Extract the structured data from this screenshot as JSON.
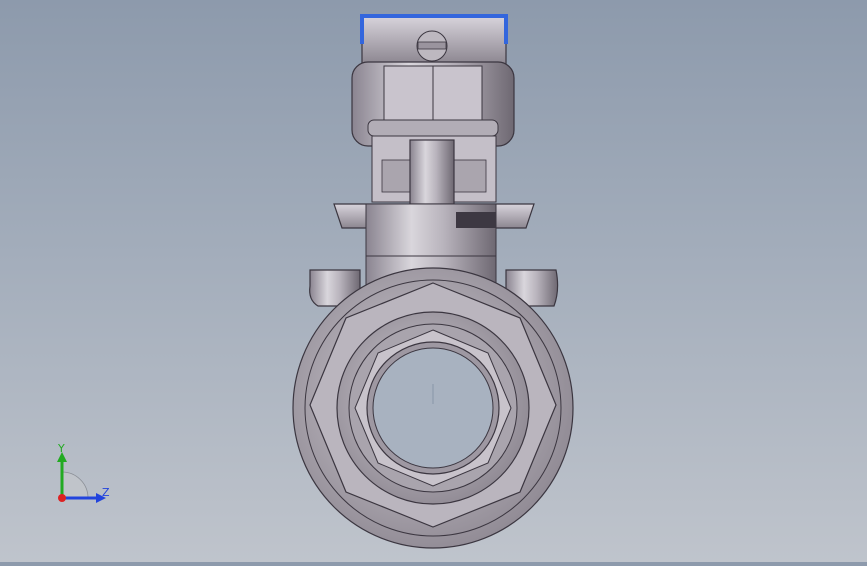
{
  "viewport": {
    "model_name": "ball-valve",
    "background_top": "#8d9aac",
    "background_bottom": "#bfc4cc",
    "handle_highlight_color": "#3366dd"
  },
  "triad": {
    "y_label": "Y",
    "z_label": "Z",
    "y_color": "#22aa22",
    "z_color": "#2244dd",
    "x_color": "#dd2222"
  }
}
